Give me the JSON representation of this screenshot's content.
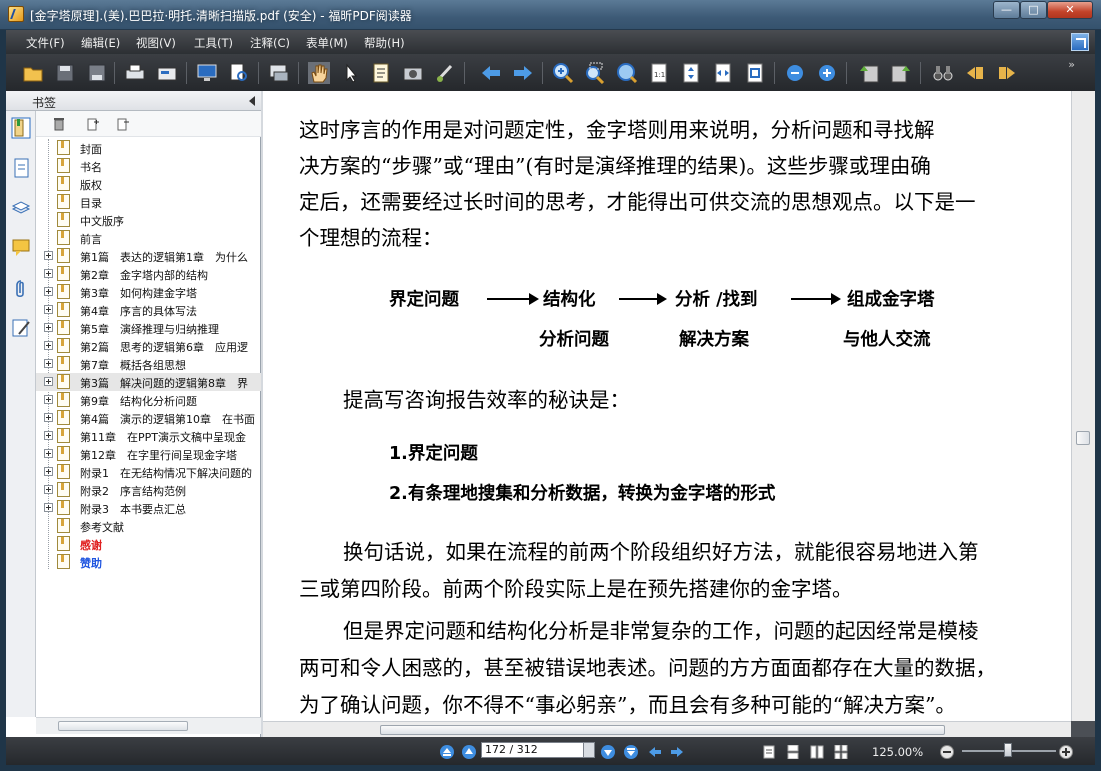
{
  "window": {
    "title": "[金字塔原理].(美).巴巴拉·明托.清晰扫描版.pdf (安全) - 福昕PDF阅读器",
    "minimize_label": "—",
    "maximize_label": "□",
    "close_label": "✕"
  },
  "menu": [
    "文件(F)",
    "编辑(E)",
    "视图(V)",
    "工具(T)",
    "注释(C)",
    "表单(M)",
    "帮助(H)"
  ],
  "toolbar": {
    "more_label": "»",
    "icons": [
      "open-folder-icon",
      "save-icon",
      "save-as-icon",
      "print-icon",
      "fax-icon",
      "screen-icon",
      "search-document-icon",
      "screen-capture-icon",
      "hand-tool-icon",
      "select-arrow-icon",
      "text-select-icon",
      "snapshot-camera-icon",
      "typewriter-icon",
      "back-arrow-icon",
      "forward-arrow-icon",
      "zoom-in-icon",
      "marquee-zoom-icon",
      "loupe-icon",
      "actual-size-icon",
      "fit-page-icon",
      "fit-width-icon",
      "fit-visible-icon",
      "zoom-out-circle-icon",
      "zoom-in-circle-icon",
      "rotate-left-icon",
      "rotate-right-icon",
      "find-binoculars-icon",
      "previous-view-icon",
      "next-view-icon"
    ]
  },
  "bookmarks_panel": {
    "title": "书签",
    "items": [
      {
        "label": "封面",
        "expandable": false
      },
      {
        "label": "书名",
        "expandable": false
      },
      {
        "label": "版权",
        "expandable": false
      },
      {
        "label": "目录",
        "expandable": false
      },
      {
        "label": "中文版序",
        "expandable": false
      },
      {
        "label": "前言",
        "expandable": false
      },
      {
        "label": "第1篇　表达的逻辑第1章　为什么",
        "expandable": true
      },
      {
        "label": "第2章　金字塔内部的结构",
        "expandable": true
      },
      {
        "label": "第3章　如何构建金字塔",
        "expandable": true
      },
      {
        "label": "第4章　序言的具体写法",
        "expandable": true
      },
      {
        "label": "第5章　演绎推理与归纳推理",
        "expandable": true
      },
      {
        "label": "第2篇　思考的逻辑第6章　应用逻",
        "expandable": true
      },
      {
        "label": "第7章　概括各组思想",
        "expandable": true
      },
      {
        "label": "第3篇　解决问题的逻辑第8章　界",
        "expandable": true,
        "selected": true
      },
      {
        "label": "第9章　结构化分析问题",
        "expandable": true
      },
      {
        "label": "第4篇　演示的逻辑第10章　在书面",
        "expandable": true
      },
      {
        "label": "第11章　在PPT演示文稿中呈现金",
        "expandable": true
      },
      {
        "label": "第12章　在字里行间呈现金字塔",
        "expandable": true
      },
      {
        "label": "附录1　在无结构情况下解决问题的",
        "expandable": true
      },
      {
        "label": "附录2　序言结构范例",
        "expandable": true
      },
      {
        "label": "附录3　本书要点汇总",
        "expandable": true
      },
      {
        "label": "参考文献",
        "expandable": false
      },
      {
        "label": "感谢",
        "expandable": false,
        "color": "#e02020"
      },
      {
        "label": "赞助",
        "expandable": false,
        "color": "#1f55e0"
      }
    ]
  },
  "document": {
    "para1": [
      "这时序言的作用是对问题定性，金字塔则用来说明，分析问题和寻找解",
      "决方案的“步骤”或“理由”(有时是演绎推理的结果)。这些步骤或理由确",
      "定后，还需要经过长时间的思考，才能得出可供交流的思想观点。以下是一",
      "个理想的流程："
    ],
    "flow": {
      "step1": "界定问题",
      "step2_line1": "结构化",
      "step2_line2": "分析问题",
      "step3_line1": "分析 /找到",
      "step3_line2": "解决方案",
      "step4_line1": "组成金字塔",
      "step4_line2": "与他人交流"
    },
    "para2": "提高写咨询报告效率的秘诀是：",
    "list": [
      "1.界定问题",
      "2.有条理地搜集和分析数据，转换为金字塔的形式"
    ],
    "para3": [
      "换句话说，如果在流程的前两个阶段组织好方法，就能很容易地进入第",
      "三或第四阶段。前两个阶段实际上是在预先搭建你的金字塔。"
    ],
    "para4": [
      "但是界定问题和结构化分析是非常复杂的工作，问题的起因经常是模棱",
      "两可和令人困惑的，甚至被错误地表述。问题的方方面面都存在大量的数据，",
      "为了确认问题，你不得不“事必躬亲”，而且会有多种可能的“解决方案”。"
    ]
  },
  "statusbar": {
    "page_value": "172 / 312",
    "zoom": "125.00%"
  },
  "colors": {
    "toolbar_bg": "#2c2f33",
    "page_bg": "#ffffff",
    "doc_bg": "#4b4f55",
    "accent_blue": "#2a6cc0"
  }
}
